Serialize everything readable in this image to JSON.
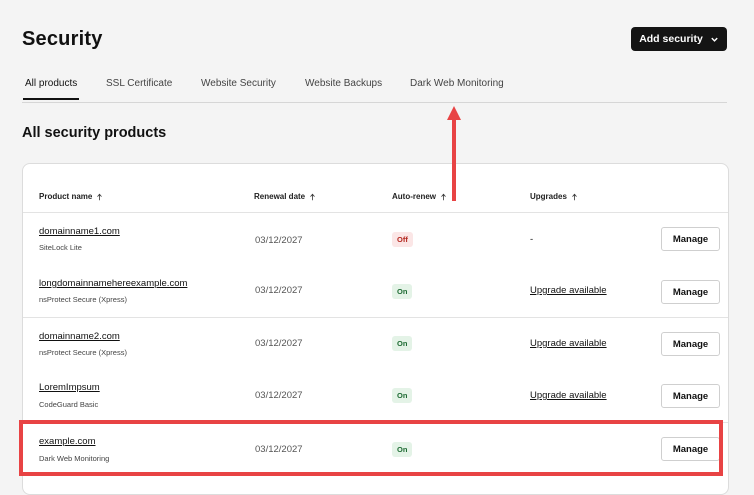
{
  "page": {
    "title": "Security"
  },
  "header": {
    "add_button_label": "Add security"
  },
  "tabs": [
    {
      "label": "All products",
      "active": true
    },
    {
      "label": "SSL Certificate",
      "active": false
    },
    {
      "label": "Website Security",
      "active": false
    },
    {
      "label": "Website Backups",
      "active": false
    },
    {
      "label": "Dark Web Monitoring",
      "active": false
    }
  ],
  "section": {
    "title": "All security products"
  },
  "table": {
    "columns": [
      "Product name",
      "Renewal date",
      "Auto-renew",
      "Upgrades"
    ],
    "rows": [
      {
        "domain": "domainname1.com",
        "plan": "SiteLock Lite",
        "date": "03/12/2027",
        "auto_renew": "Off",
        "upgrade": "-",
        "action": "Manage"
      },
      {
        "domain": "longdomainnamehereexample.com",
        "plan": "nsProtect Secure (Xpress)",
        "date": "03/12/2027",
        "auto_renew": "On",
        "upgrade": "Upgrade available",
        "action": "Manage"
      },
      {
        "domain": "domainname2.com",
        "plan": "nsProtect Secure (Xpress)",
        "date": "03/12/2027",
        "auto_renew": "On",
        "upgrade": "Upgrade available",
        "action": "Manage"
      },
      {
        "domain": "LoremImpsum",
        "plan": "CodeGuard Basic",
        "date": "03/12/2027",
        "auto_renew": "On",
        "upgrade": "Upgrade available",
        "action": "Manage"
      },
      {
        "domain": "example.com",
        "plan": "Dark Web Monitoring",
        "date": "03/12/2027",
        "auto_renew": "On",
        "upgrade": "",
        "action": "Manage"
      }
    ]
  },
  "colors": {
    "accent": "#141414",
    "highlight": "#e84344",
    "on_badge": "#e4f3e7",
    "off_badge": "#fbe6e6"
  },
  "icons": [
    "chevron-down-icon",
    "sort-arrow-icon",
    "annotation-arrow-icon"
  ]
}
